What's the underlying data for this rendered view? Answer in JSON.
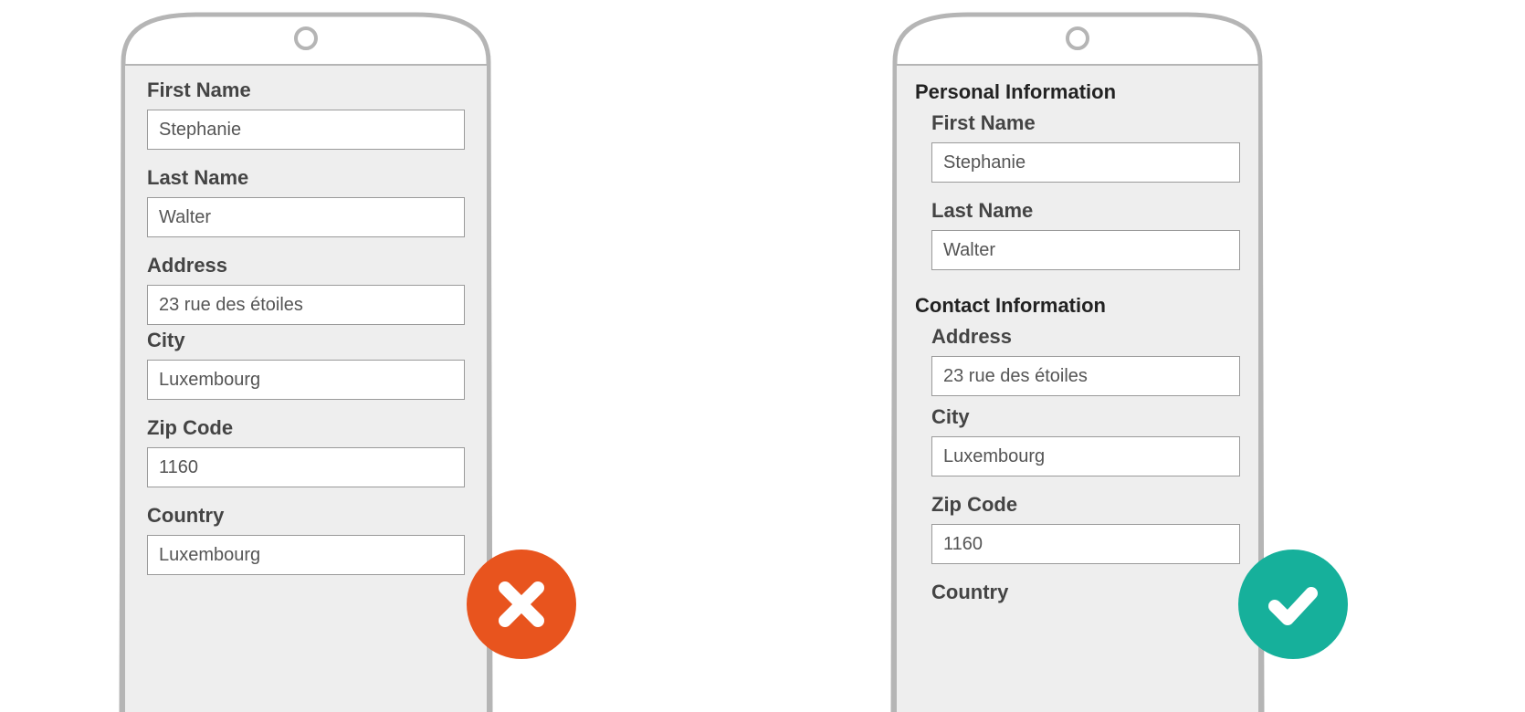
{
  "badExample": {
    "fields": {
      "first_name": {
        "label": "First Name",
        "value": "Stephanie"
      },
      "last_name": {
        "label": "Last Name",
        "value": "Walter"
      },
      "address": {
        "label": "Address",
        "value": "23 rue des étoiles"
      },
      "city": {
        "label": "City",
        "value": "Luxembourg"
      },
      "zip": {
        "label": "Zip Code",
        "value": "1160"
      },
      "country": {
        "label": "Country",
        "value": "Luxembourg"
      }
    }
  },
  "goodExample": {
    "section_personal": "Personal Information",
    "section_contact": "Contact Information",
    "fields": {
      "first_name": {
        "label": "First Name",
        "value": "Stephanie"
      },
      "last_name": {
        "label": "Last Name",
        "value": "Walter"
      },
      "address": {
        "label": "Address",
        "value": "23 rue des étoiles"
      },
      "city": {
        "label": "City",
        "value": "Luxembourg"
      },
      "zip": {
        "label": "Zip Code",
        "value": "1160"
      },
      "country": {
        "label": "Country"
      }
    }
  },
  "colors": {
    "bad": "#e8541e",
    "good": "#16b09b"
  }
}
